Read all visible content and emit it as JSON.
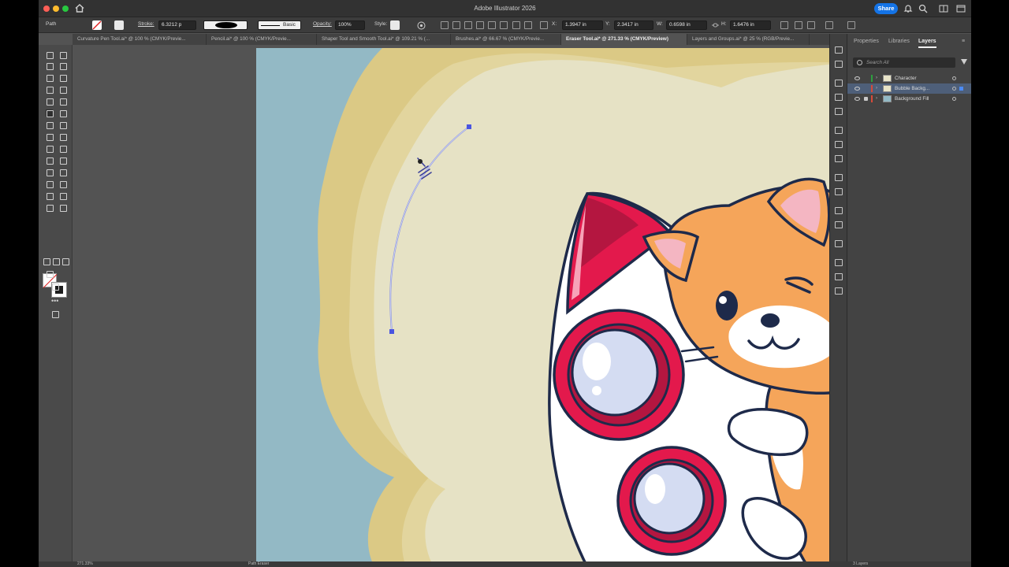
{
  "app": {
    "title": "Adobe Illustrator 2026",
    "share_label": "Share"
  },
  "control": {
    "selection_type": "Path",
    "stroke_label": "Stroke:",
    "stroke_weight": "6.3212 p",
    "profile_label": "Basic",
    "opacity_label": "Opacity:",
    "opacity_value": "100%",
    "style_label": "Style:",
    "x_label": "X:",
    "x_value": "1.3947 in",
    "y_label": "Y:",
    "y_value": "2.3417 in",
    "w_label": "W:",
    "w_value": "0.6598 in",
    "h_label": "H:",
    "h_value": "1.6476 in"
  },
  "tabs": [
    "Curvature Pen Tool.ai* @ 100 % (CMYK/Previe...",
    "Pencil.ai* @ 100 % (CMYK/Previe...",
    "Shaper Tool and Smooth Tool.ai* @ 109.21 % (...",
    "Brushes.ai* @ 66.67 % (CMYK/Previe...",
    "Eraser Tool.ai* @ 271.33 % (CMYK/Preview)",
    "Layers and Groups.ai* @ 25 % (RGB/Previe..."
  ],
  "panel": {
    "tabs": [
      "Properties",
      "Libraries",
      "Layers"
    ],
    "search_placeholder": "Search All",
    "layers": [
      {
        "name": "Character",
        "color": "#2e9e3f"
      },
      {
        "name": "Bubble Backg...",
        "color": "#d74a3a"
      },
      {
        "name": "Background Fill",
        "color": "#d74a3a"
      }
    ]
  },
  "status": {
    "zoom": "271.33%",
    "tool": "Path Eraser",
    "layers_count": "3 Layers"
  },
  "colors": {
    "accent": "#1473e6",
    "artboard_sky": "#93b9c5",
    "bubble": "#e6e2c5",
    "cat": "#f5a55a",
    "rocket_red": "#e3194c"
  }
}
